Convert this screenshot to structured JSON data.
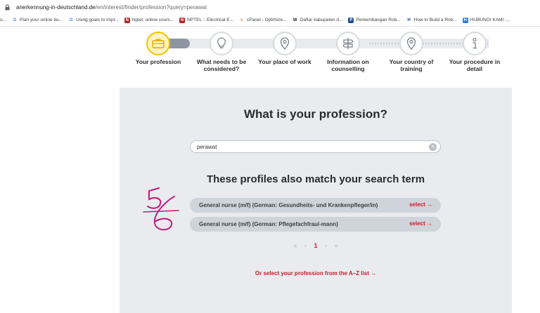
{
  "browser": {
    "url_host": "anerkennung-in-deutschland.de",
    "url_path": "/en/interest/finder/profession?query=perawat"
  },
  "bookmarks": [
    {
      "icon": "o",
      "label": "o..."
    },
    {
      "icon": "G",
      "label": "Plan your online bu..."
    },
    {
      "icon": "G",
      "label": "Using goals to impr..."
    },
    {
      "icon": "N",
      "label": "Nptel, online cours..."
    },
    {
      "icon": "N",
      "label": "NPTEL :: Electrical E..."
    },
    {
      "icon": "c",
      "label": "cPanel - Optimize..."
    },
    {
      "icon": "W",
      "label": "Daftar kabupaten d..."
    },
    {
      "icon": "P",
      "label": "Perkembangan Rob..."
    },
    {
      "icon": "H",
      "label": "How to Build a Rob..."
    },
    {
      "icon": "H",
      "label": "HUBUNGI KAMI -..."
    }
  ],
  "steps": [
    {
      "label": "Your profession",
      "icon": "briefcase-icon",
      "active": true
    },
    {
      "label": "What needs to be considered?",
      "icon": "lightbulb-icon",
      "active": false
    },
    {
      "label": "Your place of work",
      "icon": "location-pin-icon",
      "active": false
    },
    {
      "label": "Information on counselling",
      "icon": "signpost-icon",
      "active": false
    },
    {
      "label": "Your country of training",
      "icon": "location-pin-icon",
      "active": false
    },
    {
      "label": "Your procedure in detail",
      "icon": "info-icon",
      "active": false
    }
  ],
  "main": {
    "title": "What is your profession?",
    "search_value": "perawat",
    "results_heading": "These profiles also match your search term",
    "results": [
      {
        "title": "General nurse (m/f) (German: Gesundheits- und Krankenpfleger/in)",
        "action": "select →"
      },
      {
        "title": "General nurse (m/f) (German: Pflegefachfrau/-mann)",
        "action": "select →"
      }
    ],
    "pagination": {
      "first": "«",
      "prev": "‹",
      "current": "1",
      "next": "›",
      "last": "»"
    },
    "az_link": "Or select your profession from the A–Z list →"
  },
  "colors": {
    "accent_red": "#d0182b",
    "active_step": "#f2c200",
    "panel_bg": "#e9ebef"
  }
}
